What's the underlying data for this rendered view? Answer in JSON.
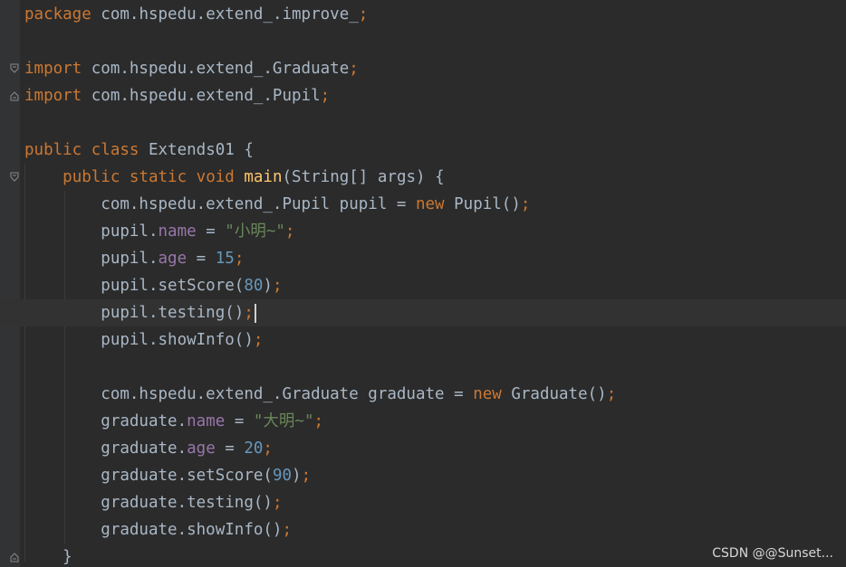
{
  "editor": {
    "language": "Java",
    "theme": "Darcula",
    "colors": {
      "background": "#2b2b2b",
      "gutter": "#313335",
      "keyword": "#cc7832",
      "string": "#6a8759",
      "number": "#6897bb",
      "field": "#9876aa",
      "method_declaration": "#ffc66d",
      "plain": "#a9b7c6"
    },
    "current_line": 12,
    "lines": [
      {
        "n": 1,
        "tokens": [
          [
            "kw",
            "package"
          ],
          [
            "pl",
            " com.hspedu.extend_.improve_"
          ],
          [
            "kw",
            ";"
          ]
        ]
      },
      {
        "n": 2,
        "tokens": []
      },
      {
        "n": 3,
        "tokens": [
          [
            "kw",
            "import"
          ],
          [
            "pl",
            " com.hspedu.extend_.Graduate"
          ],
          [
            "kw",
            ";"
          ]
        ]
      },
      {
        "n": 4,
        "tokens": [
          [
            "kw",
            "import"
          ],
          [
            "pl",
            " com.hspedu.extend_.Pupil"
          ],
          [
            "kw",
            ";"
          ]
        ]
      },
      {
        "n": 5,
        "tokens": []
      },
      {
        "n": 6,
        "tokens": [
          [
            "kw",
            "public class"
          ],
          [
            "pl",
            " Extends01 {"
          ]
        ]
      },
      {
        "n": 7,
        "tokens": [
          [
            "pl",
            "    "
          ],
          [
            "kw",
            "public static void"
          ],
          [
            "pl",
            " "
          ],
          [
            "fn",
            "main"
          ],
          [
            "pl",
            "(String[] args) {"
          ]
        ]
      },
      {
        "n": 8,
        "tokens": [
          [
            "pl",
            "        com.hspedu.extend_.Pupil pupil = "
          ],
          [
            "kw",
            "new"
          ],
          [
            "pl",
            " Pupil()"
          ],
          [
            "kw",
            ";"
          ]
        ]
      },
      {
        "n": 9,
        "tokens": [
          [
            "pl",
            "        pupil."
          ],
          [
            "fld",
            "name"
          ],
          [
            "pl",
            " = "
          ],
          [
            "str",
            "\"小明~\""
          ],
          [
            "kw",
            ";"
          ]
        ]
      },
      {
        "n": 10,
        "tokens": [
          [
            "pl",
            "        pupil."
          ],
          [
            "fld",
            "age"
          ],
          [
            "pl",
            " = "
          ],
          [
            "num",
            "15"
          ],
          [
            "kw",
            ";"
          ]
        ]
      },
      {
        "n": 11,
        "tokens": [
          [
            "pl",
            "        pupil.setScore("
          ],
          [
            "num",
            "80"
          ],
          [
            "pl",
            ")"
          ],
          [
            "kw",
            ";"
          ]
        ]
      },
      {
        "n": 12,
        "tokens": [
          [
            "pl",
            "        pupil.testing()"
          ],
          [
            "kw",
            ";"
          ]
        ]
      },
      {
        "n": 13,
        "tokens": [
          [
            "pl",
            "        pupil.showInfo()"
          ],
          [
            "kw",
            ";"
          ]
        ]
      },
      {
        "n": 14,
        "tokens": []
      },
      {
        "n": 15,
        "tokens": [
          [
            "pl",
            "        com.hspedu.extend_.Graduate graduate = "
          ],
          [
            "kw",
            "new"
          ],
          [
            "pl",
            " Graduate()"
          ],
          [
            "kw",
            ";"
          ]
        ]
      },
      {
        "n": 16,
        "tokens": [
          [
            "pl",
            "        graduate."
          ],
          [
            "fld",
            "name"
          ],
          [
            "pl",
            " = "
          ],
          [
            "str",
            "\"大明~\""
          ],
          [
            "kw",
            ";"
          ]
        ]
      },
      {
        "n": 17,
        "tokens": [
          [
            "pl",
            "        graduate."
          ],
          [
            "fld",
            "age"
          ],
          [
            "pl",
            " = "
          ],
          [
            "num",
            "20"
          ],
          [
            "kw",
            ";"
          ]
        ]
      },
      {
        "n": 18,
        "tokens": [
          [
            "pl",
            "        graduate.setScore("
          ],
          [
            "num",
            "90"
          ],
          [
            "pl",
            ")"
          ],
          [
            "kw",
            ";"
          ]
        ]
      },
      {
        "n": 19,
        "tokens": [
          [
            "pl",
            "        graduate.testing()"
          ],
          [
            "kw",
            ";"
          ]
        ]
      },
      {
        "n": 20,
        "tokens": [
          [
            "pl",
            "        graduate.showInfo()"
          ],
          [
            "kw",
            ";"
          ]
        ]
      },
      {
        "n": 21,
        "tokens": [
          [
            "pl",
            "    }"
          ]
        ]
      }
    ],
    "fold_markers": [
      {
        "line": 3,
        "icon": "fold-open-icon"
      },
      {
        "line": 4,
        "icon": "fold-close-icon"
      },
      {
        "line": 7,
        "icon": "fold-open-icon"
      },
      {
        "line": 21,
        "icon": "fold-close-icon"
      }
    ]
  },
  "watermark": {
    "text": "CSDN @@Sunset..."
  }
}
